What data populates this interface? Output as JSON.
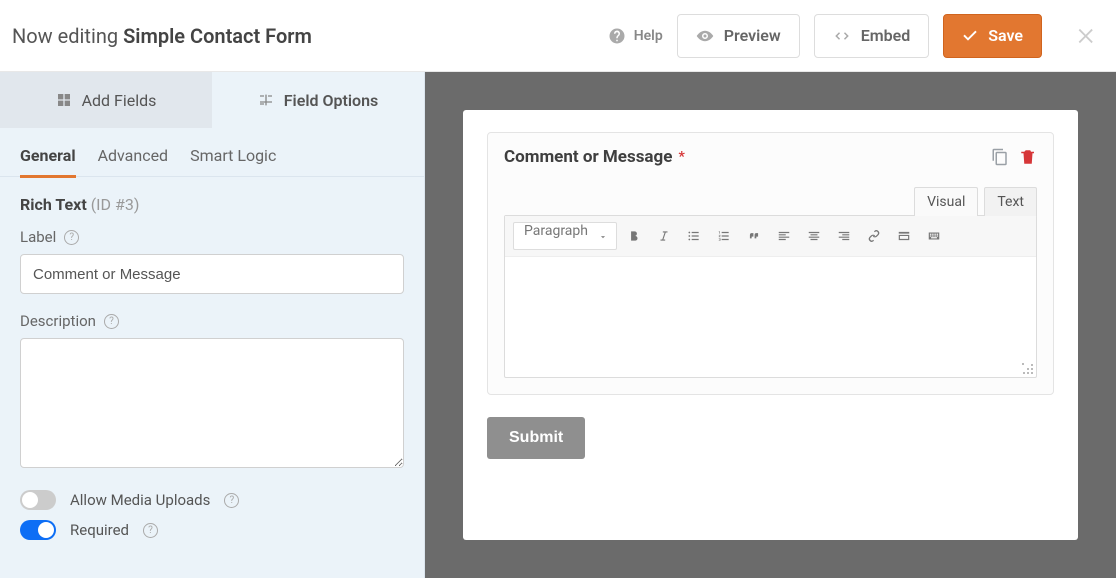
{
  "header": {
    "prefix": "Now editing",
    "form_name": "Simple Contact Form",
    "help": "Help",
    "preview": "Preview",
    "embed": "Embed",
    "save": "Save"
  },
  "side": {
    "tab_add": "Add Fields",
    "tab_options": "Field Options",
    "subtabs": {
      "general": "General",
      "advanced": "Advanced",
      "smart": "Smart Logic"
    },
    "section": {
      "type": "Rich Text",
      "id_label": "(ID #3)"
    },
    "label": {
      "title": "Label",
      "value": "Comment or Message"
    },
    "description": {
      "title": "Description",
      "value": ""
    },
    "toggles": {
      "media_uploads": {
        "label": "Allow Media Uploads",
        "on": false
      },
      "required": {
        "label": "Required",
        "on": true
      }
    }
  },
  "form": {
    "field_label": "Comment or Message",
    "required": true,
    "editor_tabs": {
      "visual": "Visual",
      "text": "Text"
    },
    "paragraph_select": "Paragraph",
    "submit": "Submit"
  }
}
